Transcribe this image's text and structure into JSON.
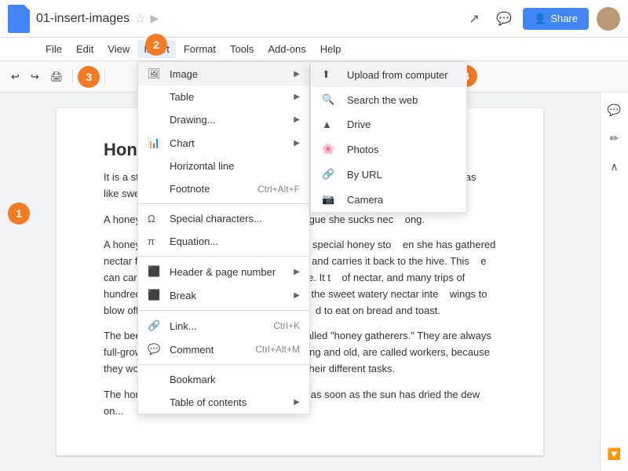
{
  "title": "01-insert-images",
  "topbar": {
    "doc_title": "01-insert-images",
    "share_label": "Share"
  },
  "menubar": {
    "items": [
      "File",
      "Edit",
      "View",
      "Insert",
      "Format",
      "Tools",
      "Add-ons",
      "Help"
    ]
  },
  "toolbar": {
    "undo_label": "↩",
    "redo_label": "↪"
  },
  "insert_menu": {
    "items": [
      {
        "icon": "🖼",
        "label": "Image",
        "has_arrow": true
      },
      {
        "icon": "",
        "label": "Table",
        "has_arrow": true
      },
      {
        "icon": "",
        "label": "Drawing...",
        "has_arrow": false
      },
      {
        "icon": "📊",
        "label": "Chart",
        "has_arrow": true
      },
      {
        "icon": "",
        "label": "Horizontal line",
        "has_arrow": false
      },
      {
        "icon": "",
        "label": "Footnote",
        "shortcut": "Ctrl+Alt+F",
        "has_arrow": false
      },
      {
        "icon": "",
        "label": "Special characters...",
        "has_arrow": false
      },
      {
        "icon": "π",
        "label": "Equation...",
        "has_arrow": false
      },
      {
        "icon": "",
        "label": "Header & page number",
        "has_arrow": true
      },
      {
        "icon": "⬛",
        "label": "Break",
        "has_arrow": true
      },
      {
        "icon": "🔗",
        "label": "Link...",
        "shortcut": "Ctrl+K",
        "has_arrow": false
      },
      {
        "icon": "💬",
        "label": "Comment",
        "shortcut": "Ctrl+Alt+M",
        "has_arrow": false
      },
      {
        "icon": "",
        "label": "Bookmark",
        "has_arrow": false
      },
      {
        "icon": "",
        "label": "Table of contents",
        "has_arrow": true
      }
    ]
  },
  "image_submenu": {
    "items": [
      {
        "icon": "upload",
        "label": "Upload from computer"
      },
      {
        "icon": "search",
        "label": "Search the web"
      },
      {
        "icon": "drive",
        "label": "Drive"
      },
      {
        "icon": "photos",
        "label": "Photos"
      },
      {
        "icon": "url",
        "label": "By URL"
      },
      {
        "icon": "camera",
        "label": "Camera"
      }
    ]
  },
  "document": {
    "heading": "Honey",
    "paragraphs": [
      "It is a still, calm day. A bee is flying from flower to flower as  the cup of a flower as  like sweet  always a c  is on a plant or tree there is nearly",
      "A honeyb  e that of a mosquito. With this tongue she sucks nec  ong.",
      "A honeyb  food she eats; while the other is a special honey sto  en she has gathered nectar from a clover or an appl  r honey sac, and carries it back to the hive. This  e can carry only one drop of nectar in it at a time. It t  of nectar, and many trips of hundreds of bees to m  he hive the bees put the sweet watery nectar inte  wings to blow off the extra moisture. In this way it bec  d to eat on bread and toast.",
      "The bees  ...  getting nectar from flowers are called \"honey gatherers.\" They are always full-grown \"lady\" bees. All lady bees, both young and old, are called workers, because they work very hard from morning to night at their different tasks.",
      "The honey gatherers start out in the morning, as soon as the sun has dried the dew on..."
    ]
  },
  "badges": {
    "one": "1",
    "two": "2",
    "three": "3",
    "four": "4"
  }
}
